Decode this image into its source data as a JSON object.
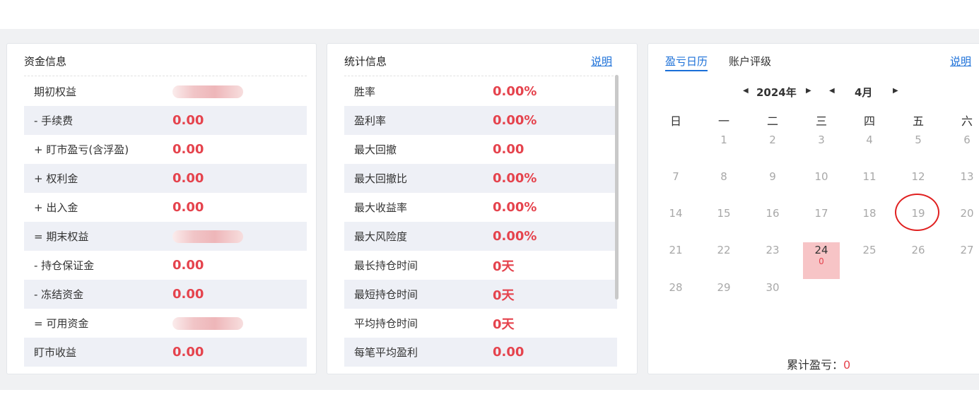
{
  "capital_panel": {
    "title": "资金信息",
    "rows": [
      {
        "label": "期初权益",
        "value": null
      },
      {
        "label": "- 手续费",
        "value": "0.00"
      },
      {
        "label": "+ 盯市盈亏(含浮盈)",
        "value": "0.00"
      },
      {
        "label": "+ 权利金",
        "value": "0.00"
      },
      {
        "label": "+ 出入金",
        "value": "0.00"
      },
      {
        "label": "= 期末权益",
        "value": null
      },
      {
        "label": "- 持仓保证金",
        "value": "0.00"
      },
      {
        "label": "- 冻结资金",
        "value": "0.00"
      },
      {
        "label": "= 可用资金",
        "value": null
      },
      {
        "label": "盯市收益",
        "value": "0.00"
      }
    ]
  },
  "stats_panel": {
    "title": "统计信息",
    "help_label": "说明",
    "rows": [
      {
        "label": "胜率",
        "value": "0.00%"
      },
      {
        "label": "盈利率",
        "value": "0.00%"
      },
      {
        "label": "最大回撤",
        "value": "0.00"
      },
      {
        "label": "最大回撤比",
        "value": "0.00%"
      },
      {
        "label": "最大收益率",
        "value": "0.00%"
      },
      {
        "label": "最大风险度",
        "value": "0.00%"
      },
      {
        "label": "最长持仓时间",
        "value": "0天"
      },
      {
        "label": "最短持仓时间",
        "value": "0天"
      },
      {
        "label": "平均持仓时间",
        "value": "0天"
      },
      {
        "label": "每笔平均盈利",
        "value": "0.00"
      }
    ]
  },
  "calendar_panel": {
    "tabs": [
      "盈亏日历",
      "账户评级"
    ],
    "active_tab": 0,
    "help_label": "说明",
    "year_label": "2024年",
    "month_label": "4月",
    "weekdays": [
      "日",
      "一",
      "二",
      "三",
      "四",
      "五",
      "六"
    ],
    "highlighted_day": {
      "day": "24",
      "pl": "0"
    },
    "circled_day": "19",
    "cumulative_label": "累计盈亏：",
    "cumulative_value": "0"
  },
  "colors": {
    "accent": "#1a6fd8",
    "value_red": "#e5434d",
    "row_alt": "#eef0f6",
    "highlight_day": "#f7c4c6",
    "circle": "#e02020"
  }
}
